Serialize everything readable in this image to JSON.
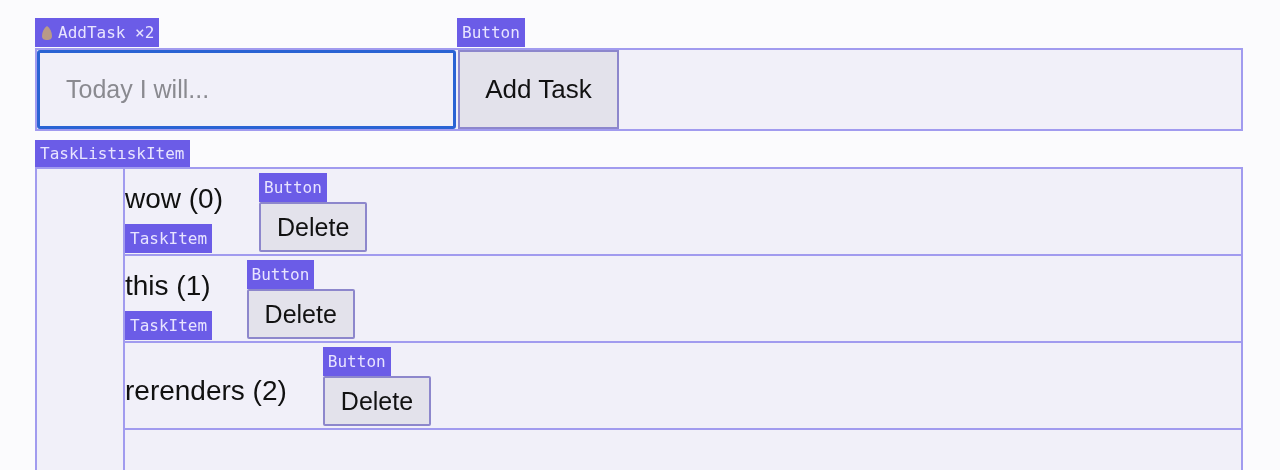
{
  "add_task": {
    "overlay_label": "AddTask ×2",
    "input": {
      "placeholder": "Today I will..."
    },
    "button": {
      "overlay_label": "Button",
      "label": "Add Task"
    }
  },
  "task_list": {
    "overlay_label": "TaskListıskItem",
    "items": [
      {
        "text": "wow (0)",
        "overlay_label": "TaskItem",
        "button_overlay_label": "Button",
        "button": "Delete"
      },
      {
        "text": "this (1)",
        "overlay_label": "TaskItem",
        "button_overlay_label": "Button",
        "button": "Delete"
      },
      {
        "text": "rerenders (2)",
        "button_overlay_label": "Button",
        "button": "Delete"
      }
    ]
  }
}
